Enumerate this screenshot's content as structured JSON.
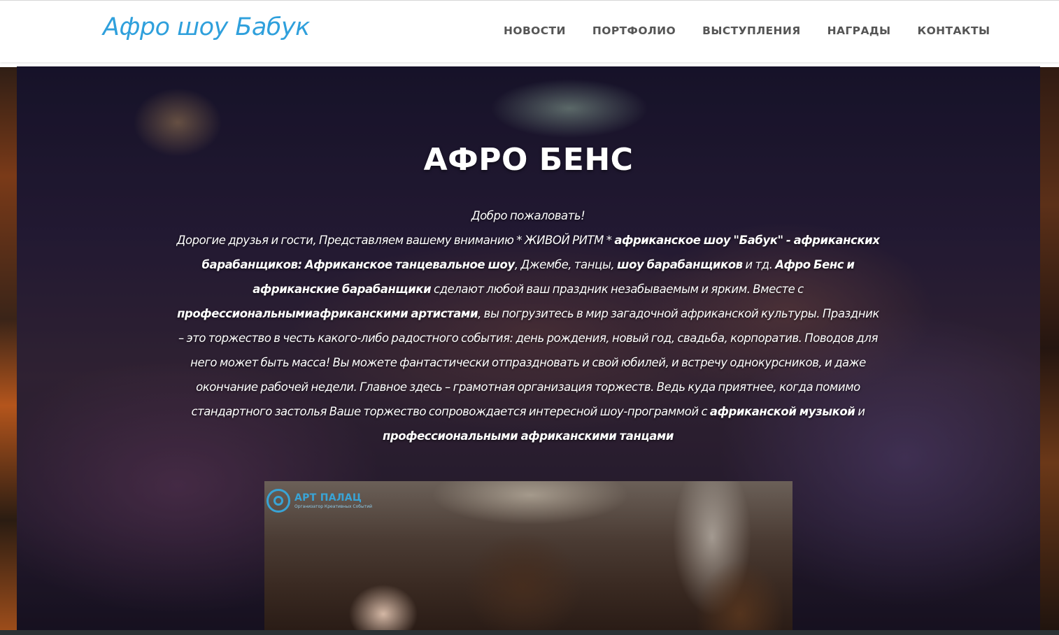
{
  "header": {
    "logo": "Афро шоу Бабук",
    "nav": [
      {
        "label": "НОВОСТИ"
      },
      {
        "label": "ПОРТФОЛИО"
      },
      {
        "label": "ВЫСТУПЛЕНИЯ"
      },
      {
        "label": "НАГРАДЫ"
      },
      {
        "label": "КОНТАКТЫ"
      }
    ]
  },
  "hero": {
    "title": "АФРО БЕНС",
    "welcome": "Добро пожаловать!",
    "intro": "Дорогие друзья и гости, Представляем вашему вниманию * ЖИВОЙ РИТМ * ",
    "b1": "африканское шоу \"Бабук\"  - африканских барабанщиков: Африканское танцевальное шоу",
    "t1": ", Джембе, танцы, ",
    "b2": "шоу барабанщиков",
    "t2": " и тд. ",
    "b3": "Афро Бенс и африканские барабанщики",
    "t3": " сделают любой ваш праздник незабываемым и ярким. Вместе с ",
    "b4": "профессиональнымиафриканскими артистами",
    "t4": ", вы погрузитесь в мир загадочной африканской культуры. Праздник – это торжество в честь какого-либо радостного события: день рождения, новый год, свадьба, корпоратив. Поводов для него может быть масса! Вы можете фантастически отпраздновать и свой юбилей, и встречу однокурсников, и даже окончание рабочей недели. Главное здесь – грамотная организация торжеств. Ведь куда приятнее, когда помимо стандартного застолья Ваше торжество сопровождается интересной шоу-программой с ",
    "b5": "африканской музыкой",
    "t5": " и ",
    "b6": "профессиональными африканскими танцами"
  },
  "inset": {
    "logo_name": "АРТ ПАЛАЦ",
    "logo_sub": "Организатор Креативных Событий"
  },
  "colors": {
    "logo": "#2fa0dc",
    "nav": "#555555",
    "hero_text": "#ffffff"
  }
}
